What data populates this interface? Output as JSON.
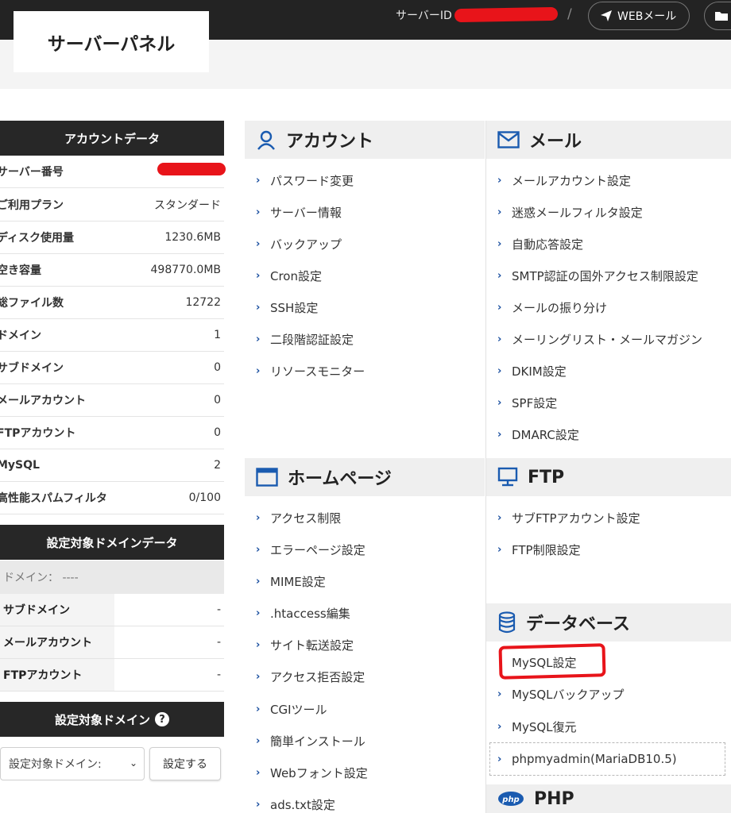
{
  "topbar": {
    "server_id_label": "サーバーID",
    "slash": "/",
    "webmail_label": "WEBメール"
  },
  "header": {
    "title": "サーバーパネル"
  },
  "account_data": {
    "heading": "アカウントデータ",
    "rows": [
      {
        "key": "サーバー番号",
        "value": ""
      },
      {
        "key": "ご利用プラン",
        "value": "スタンダード"
      },
      {
        "key": "ディスク使用量",
        "value": "1230.6MB"
      },
      {
        "key": "空き容量",
        "value": "498770.0MB"
      },
      {
        "key": "総ファイル数",
        "value": "12722"
      },
      {
        "key": "ドメイン",
        "value": "1"
      },
      {
        "key": "サブドメイン",
        "value": "0"
      },
      {
        "key": "メールアカウント",
        "value": "0"
      },
      {
        "key": "FTPアカウント",
        "value": "0"
      },
      {
        "key": "MySQL",
        "value": "2"
      },
      {
        "key": "高性能スパムフィルタ",
        "value": "0/100"
      }
    ]
  },
  "domain_data": {
    "heading": "設定対象ドメインデータ",
    "domain_line": "ドメイン： ----",
    "rows": [
      {
        "key": "サブドメイン",
        "value": "-"
      },
      {
        "key": "メールアカウント",
        "value": "-"
      },
      {
        "key": "FTPアカウント",
        "value": "-"
      }
    ]
  },
  "target_domain": {
    "heading": "設定対象ドメイン",
    "help": "?",
    "select_value": "設定対象ドメイン:",
    "chevron": "⌄",
    "button_label": "設定する"
  },
  "sections": {
    "account": {
      "title": "アカウント",
      "items": [
        "パスワード変更",
        "サーバー情報",
        "バックアップ",
        "Cron設定",
        "SSH設定",
        "二段階認証設定",
        "リソースモニター"
      ]
    },
    "mail": {
      "title": "メール",
      "items": [
        "メールアカウント設定",
        "迷惑メールフィルタ設定",
        "自動応答設定",
        "SMTP認証の国外アクセス制限設定",
        "メールの振り分け",
        "メーリングリスト・メールマガジン",
        "DKIM設定",
        "SPF設定",
        "DMARC設定"
      ]
    },
    "homepage": {
      "title": "ホームページ",
      "items": [
        "アクセス制限",
        "エラーページ設定",
        "MIME設定",
        ".htaccess編集",
        "サイト転送設定",
        "アクセス拒否設定",
        "CGIツール",
        "簡単インストール",
        "Webフォント設定",
        "ads.txt設定"
      ]
    },
    "ftp": {
      "title": "FTP",
      "items": [
        "サブFTPアカウント設定",
        "FTP制限設定"
      ]
    },
    "database": {
      "title": "データベース",
      "items": [
        "MySQL設定",
        "MySQLバックアップ",
        "MySQL復元",
        "phpmyadmin(MariaDB10.5)"
      ]
    },
    "php": {
      "title": "PHP"
    }
  },
  "arrow_glyph": "›",
  "colors": {
    "topbar": "#232323",
    "sidebar_heading": "#272727",
    "section_heading": "#efefef",
    "icon_blue": "#1a5bb0",
    "redaction_red": "#e8141a"
  }
}
